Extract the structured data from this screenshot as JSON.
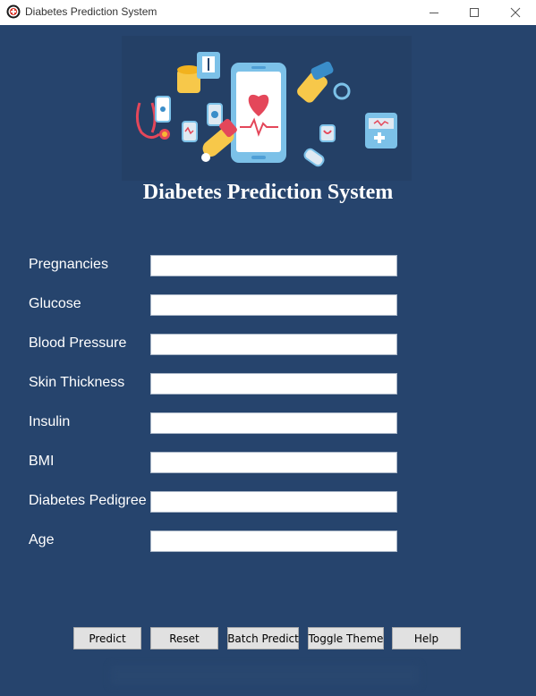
{
  "window": {
    "title": "Diabetes Prediction System",
    "icon": "app-icon"
  },
  "header": {
    "title": "Diabetes Prediction System",
    "banner_icons": [
      "stethoscope-icon",
      "smartphone-icon",
      "smartwatch-icon",
      "heart-icon",
      "heartbeat-icon",
      "glucose-meter-icon",
      "insulin-pen-icon",
      "fitness-band-icon",
      "medicine-box-icon"
    ]
  },
  "form": {
    "fields": [
      {
        "label": "Pregnancies",
        "value": ""
      },
      {
        "label": "Glucose",
        "value": ""
      },
      {
        "label": "Blood Pressure",
        "value": ""
      },
      {
        "label": "Skin Thickness",
        "value": ""
      },
      {
        "label": "Insulin",
        "value": ""
      },
      {
        "label": "BMI",
        "value": ""
      },
      {
        "label": "Diabetes Pedigree",
        "value": ""
      },
      {
        "label": "Age",
        "value": ""
      }
    ]
  },
  "buttons": {
    "predict": "Predict",
    "reset": "Reset",
    "batch_predict": "Batch Predict",
    "toggle_theme": "Toggle Theme",
    "help": "Help"
  },
  "colors": {
    "background": "#26446d",
    "text": "#ffffff",
    "button": "#e1e1e1"
  }
}
